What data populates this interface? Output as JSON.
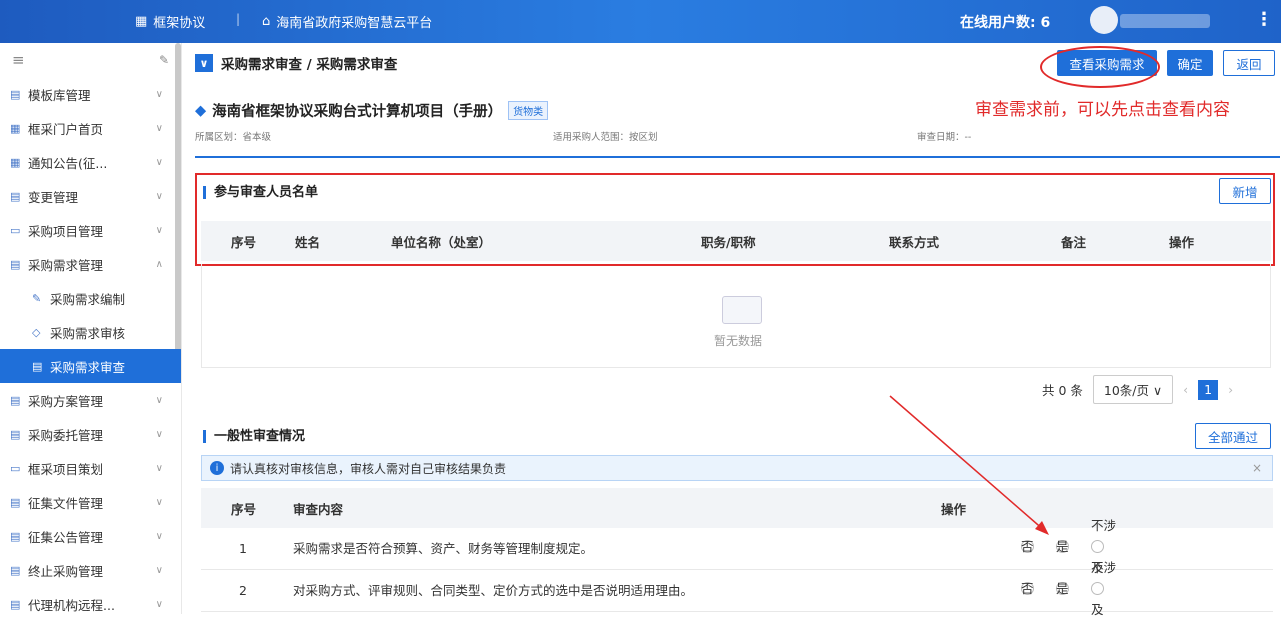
{
  "top": {
    "framework_label": "框架协议",
    "sep": "|",
    "platform_title": "海南省政府采购智慧云平台",
    "online_users": "在线用户数: 6"
  },
  "sidebar": {
    "items": [
      {
        "label": "模板库管理"
      },
      {
        "label": "框采门户首页"
      },
      {
        "label": "通知公告(征..."
      },
      {
        "label": "变更管理"
      },
      {
        "label": "采购项目管理"
      },
      {
        "label": "采购需求管理"
      }
    ],
    "sub_items": [
      {
        "label": "采购需求编制"
      },
      {
        "label": "采购需求审核"
      },
      {
        "label": "采购需求审查"
      }
    ],
    "items2": [
      {
        "label": "采购方案管理"
      },
      {
        "label": "采购委托管理"
      },
      {
        "label": "框采项目策划"
      },
      {
        "label": "征集文件管理"
      },
      {
        "label": "征集公告管理"
      },
      {
        "label": "终止采购管理"
      },
      {
        "label": "代理机构远程..."
      }
    ]
  },
  "header": {
    "breadcrumb": "采购需求审查 / 采购需求审查",
    "view_btn": "查看采购需求",
    "confirm_btn": "确定",
    "back_btn": "返回"
  },
  "annotation": "审查需求前，可以先点击查看内容",
  "project": {
    "title": "海南省框架协议采购台式计算机项目（手册）",
    "tag": "货物类",
    "region": "所属区划：省本级",
    "scope": "适用采购人范围：按区划",
    "date": "审查日期：--"
  },
  "reviewers": {
    "title": "参与审查人员名单",
    "add_btn": "新增",
    "columns": [
      "序号",
      "姓名",
      "单位名称（处室）",
      "职务/职称",
      "联系方式",
      "备注",
      "操作"
    ],
    "empty": "暂无数据"
  },
  "pagination": {
    "total": "共 0 条",
    "size": "10条/页",
    "page": "1"
  },
  "general": {
    "title": "一般性审查情况",
    "pass_all_btn": "全部通过",
    "info": "请认真核对审核信息，审核人需对自己审核结果负责",
    "columns": [
      "序号",
      "审查内容",
      "操作"
    ],
    "rows": [
      {
        "no": "1",
        "content": "采购需求是否符合预算、资产、财务等管理制度规定。"
      },
      {
        "no": "2",
        "content": "对采购方式、评审规则、合同类型、定价方式的选中是否说明适用理由。"
      }
    ],
    "options": [
      "否",
      "是",
      "不涉及"
    ]
  },
  "colors": {
    "primary": "#1f6fd9",
    "annotation": "#e12a2a"
  }
}
